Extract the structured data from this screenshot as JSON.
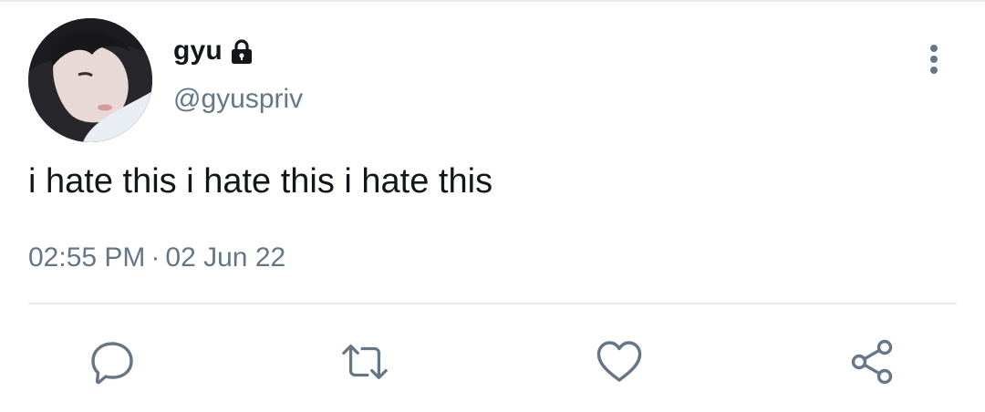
{
  "tweet": {
    "author": {
      "display_name": "gyu",
      "handle": "@gyuspriv",
      "protected": true
    },
    "text": "i hate this i hate this i hate this",
    "time": "02:55 PM",
    "separator": "·",
    "date": "02 Jun 22"
  },
  "icons": {
    "lock": "lock-icon",
    "more": "more-vertical-icon",
    "reply": "reply-icon",
    "retweet": "retweet-icon",
    "like": "heart-icon",
    "share": "share-icon"
  },
  "colors": {
    "text_primary": "#14171a",
    "text_secondary": "#657786",
    "icon": "#657786",
    "divider": "#e6ecf0"
  }
}
